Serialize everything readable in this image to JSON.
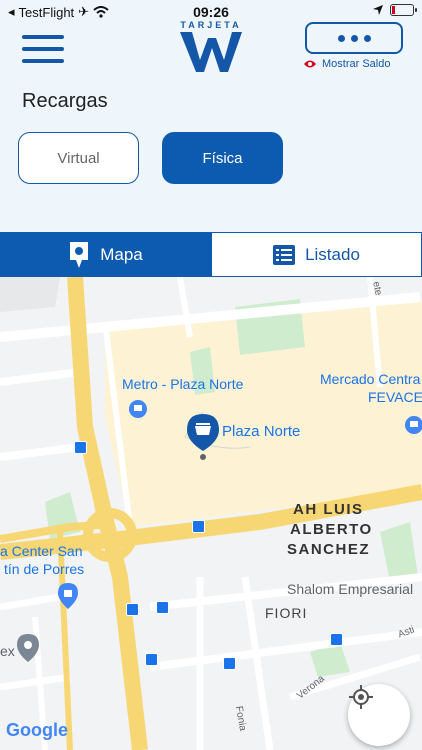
{
  "status_bar": {
    "carrier": "TestFlight",
    "time": "09:26"
  },
  "header": {
    "logo_text": "TARJETA",
    "logo_letter": "W",
    "show_balance": "Mostrar Saldo"
  },
  "page": {
    "title": "Recargas"
  },
  "segments": {
    "virtual": "Virtual",
    "fisica": "Física"
  },
  "tabs": {
    "mapa": "Mapa",
    "listado": "Listado"
  },
  "map": {
    "labels": {
      "metro": "Metro - Plaza Norte",
      "plaza_norte": "Plaza Norte",
      "mercado": "Mercado Centra",
      "fevace": "FEVACE",
      "ah_luis_1": "AH LUIS",
      "ah_luis_2": "ALBERTO",
      "ah_luis_3": "SANCHEZ",
      "center_1": "a Center San",
      "center_2": "tín de Porres",
      "shalom": "Shalom Empresarial",
      "fiori": "FIORI",
      "ex": "ex",
      "verona": "Verona",
      "fonia": "Fonia",
      "asti": "Asti",
      "ete": "ete",
      "google": "Google"
    }
  },
  "colors": {
    "primary": "#0d5bb0",
    "accent_red": "#d0021b",
    "map_blue": "#1a73e8",
    "road_yellow": "#f7d774"
  }
}
